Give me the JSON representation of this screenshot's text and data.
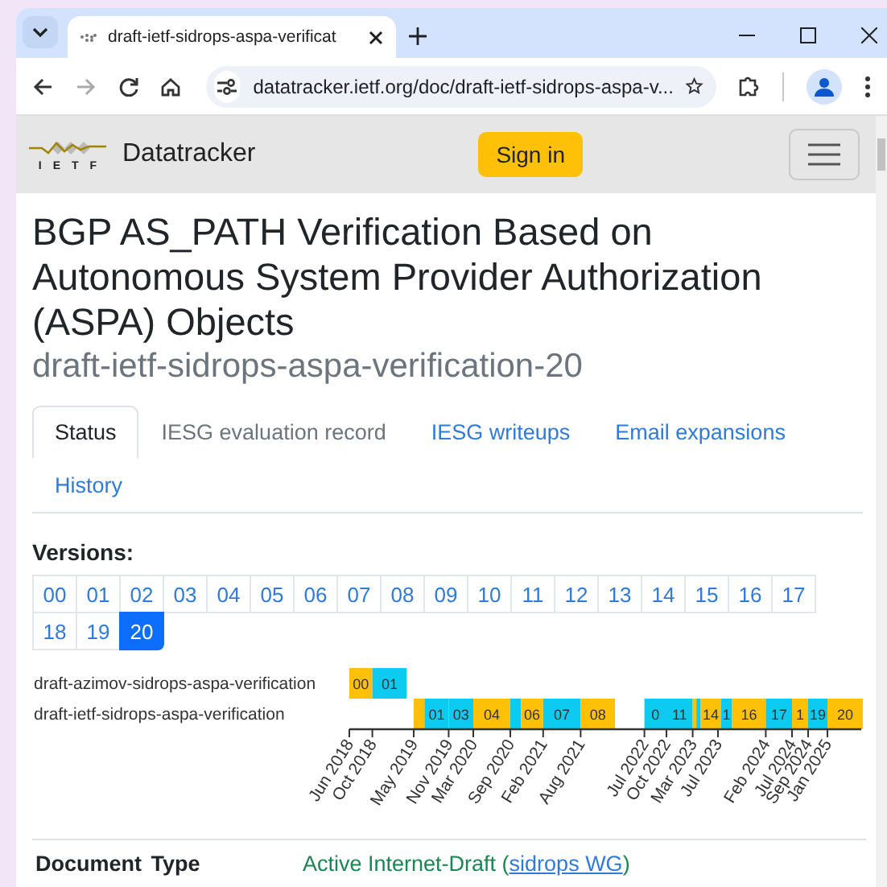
{
  "browser": {
    "tab_title": "draft-ietf-sidrops-aspa-verificat",
    "url": "datatracker.ietf.org/doc/draft-ietf-sidrops-aspa-v..."
  },
  "navbar": {
    "logo_text": "IETF",
    "site_name": "Datatracker",
    "sign_in": "Sign in"
  },
  "document": {
    "title": "BGP AS_PATH Verification Based on Autonomous System Provider Authorization (ASPA) Objects",
    "name": "draft-ietf-sidrops-aspa-verification-20"
  },
  "tabs": [
    {
      "label": "Status",
      "selected": true,
      "disabled": false
    },
    {
      "label": "IESG evaluation record",
      "selected": false,
      "disabled": true
    },
    {
      "label": "IESG writeups",
      "selected": false,
      "disabled": false
    },
    {
      "label": "Email expansions",
      "selected": false,
      "disabled": false
    },
    {
      "label": "History",
      "selected": false,
      "disabled": false
    }
  ],
  "versions": {
    "label": "Versions:",
    "items": [
      {
        "label": "00",
        "selected": false
      },
      {
        "label": "01",
        "selected": false
      },
      {
        "label": "02",
        "selected": false
      },
      {
        "label": "03",
        "selected": false
      },
      {
        "label": "04",
        "selected": false
      },
      {
        "label": "05",
        "selected": false
      },
      {
        "label": "06",
        "selected": false
      },
      {
        "label": "07",
        "selected": false
      },
      {
        "label": "08",
        "selected": false
      },
      {
        "label": "09",
        "selected": false
      },
      {
        "label": "10",
        "selected": false
      },
      {
        "label": "11",
        "selected": false
      },
      {
        "label": "12",
        "selected": false
      },
      {
        "label": "13",
        "selected": false
      },
      {
        "label": "14",
        "selected": false
      },
      {
        "label": "15",
        "selected": false
      },
      {
        "label": "16",
        "selected": false
      },
      {
        "label": "17",
        "selected": false
      },
      {
        "label": "18",
        "selected": false
      },
      {
        "label": "19",
        "selected": false
      },
      {
        "label": "20",
        "selected": true
      }
    ]
  },
  "timeline": {
    "rows": [
      {
        "name": "draft-azimov-sidrops-aspa-verification",
        "segments": [
          {
            "label": "00",
            "color": "#ffc107"
          },
          {
            "label": "01",
            "color": "#0dcaf0"
          }
        ]
      },
      {
        "name": "draft-ietf-sidrops-aspa-verification",
        "segments": [
          {
            "color": "#ffc107"
          },
          {
            "label": "01",
            "color": "#0dcaf0"
          },
          {
            "label": "03",
            "color": "#0dcaf0"
          },
          {
            "label": "04",
            "color": "#ffc107"
          },
          {
            "color": "#0dcaf0"
          },
          {
            "label": "06",
            "color": "#ffc107"
          },
          {
            "label": "07",
            "color": "#0dcaf0"
          },
          {
            "label": "08",
            "color": "#ffc107"
          },
          {
            "label": "0",
            "color": "#0dcaf0"
          },
          {
            "label": "11",
            "color": "#0dcaf0"
          },
          {
            "color": "#ffc107"
          },
          {
            "color": "#0dcaf0"
          },
          {
            "label": "14",
            "color": "#ffc107"
          },
          {
            "label": "1",
            "color": "#0dcaf0"
          },
          {
            "label": "16",
            "color": "#ffc107"
          },
          {
            "label": "17",
            "color": "#0dcaf0"
          },
          {
            "label": "1",
            "color": "#ffc107"
          },
          {
            "label": "19",
            "color": "#0dcaf0"
          },
          {
            "label": "20",
            "color": "#ffc107"
          }
        ]
      }
    ],
    "ticks": [
      "Jun 2018",
      "Oct 2018",
      "May 2019",
      "Nov 2019",
      "Mar 2020",
      "Sep 2020",
      "Feb 2021",
      "Aug 2021",
      "Jul 2022",
      "Oct 2022",
      "Mar 2023",
      "Jul 2023",
      "Feb 2024",
      "Jul 2024",
      "Sep 2024",
      "Jan 2025"
    ]
  },
  "document_type": {
    "label": "Document Type",
    "prefix": "Active Internet-Draft (",
    "link": "sidrops WG",
    "suffix": ")"
  }
}
